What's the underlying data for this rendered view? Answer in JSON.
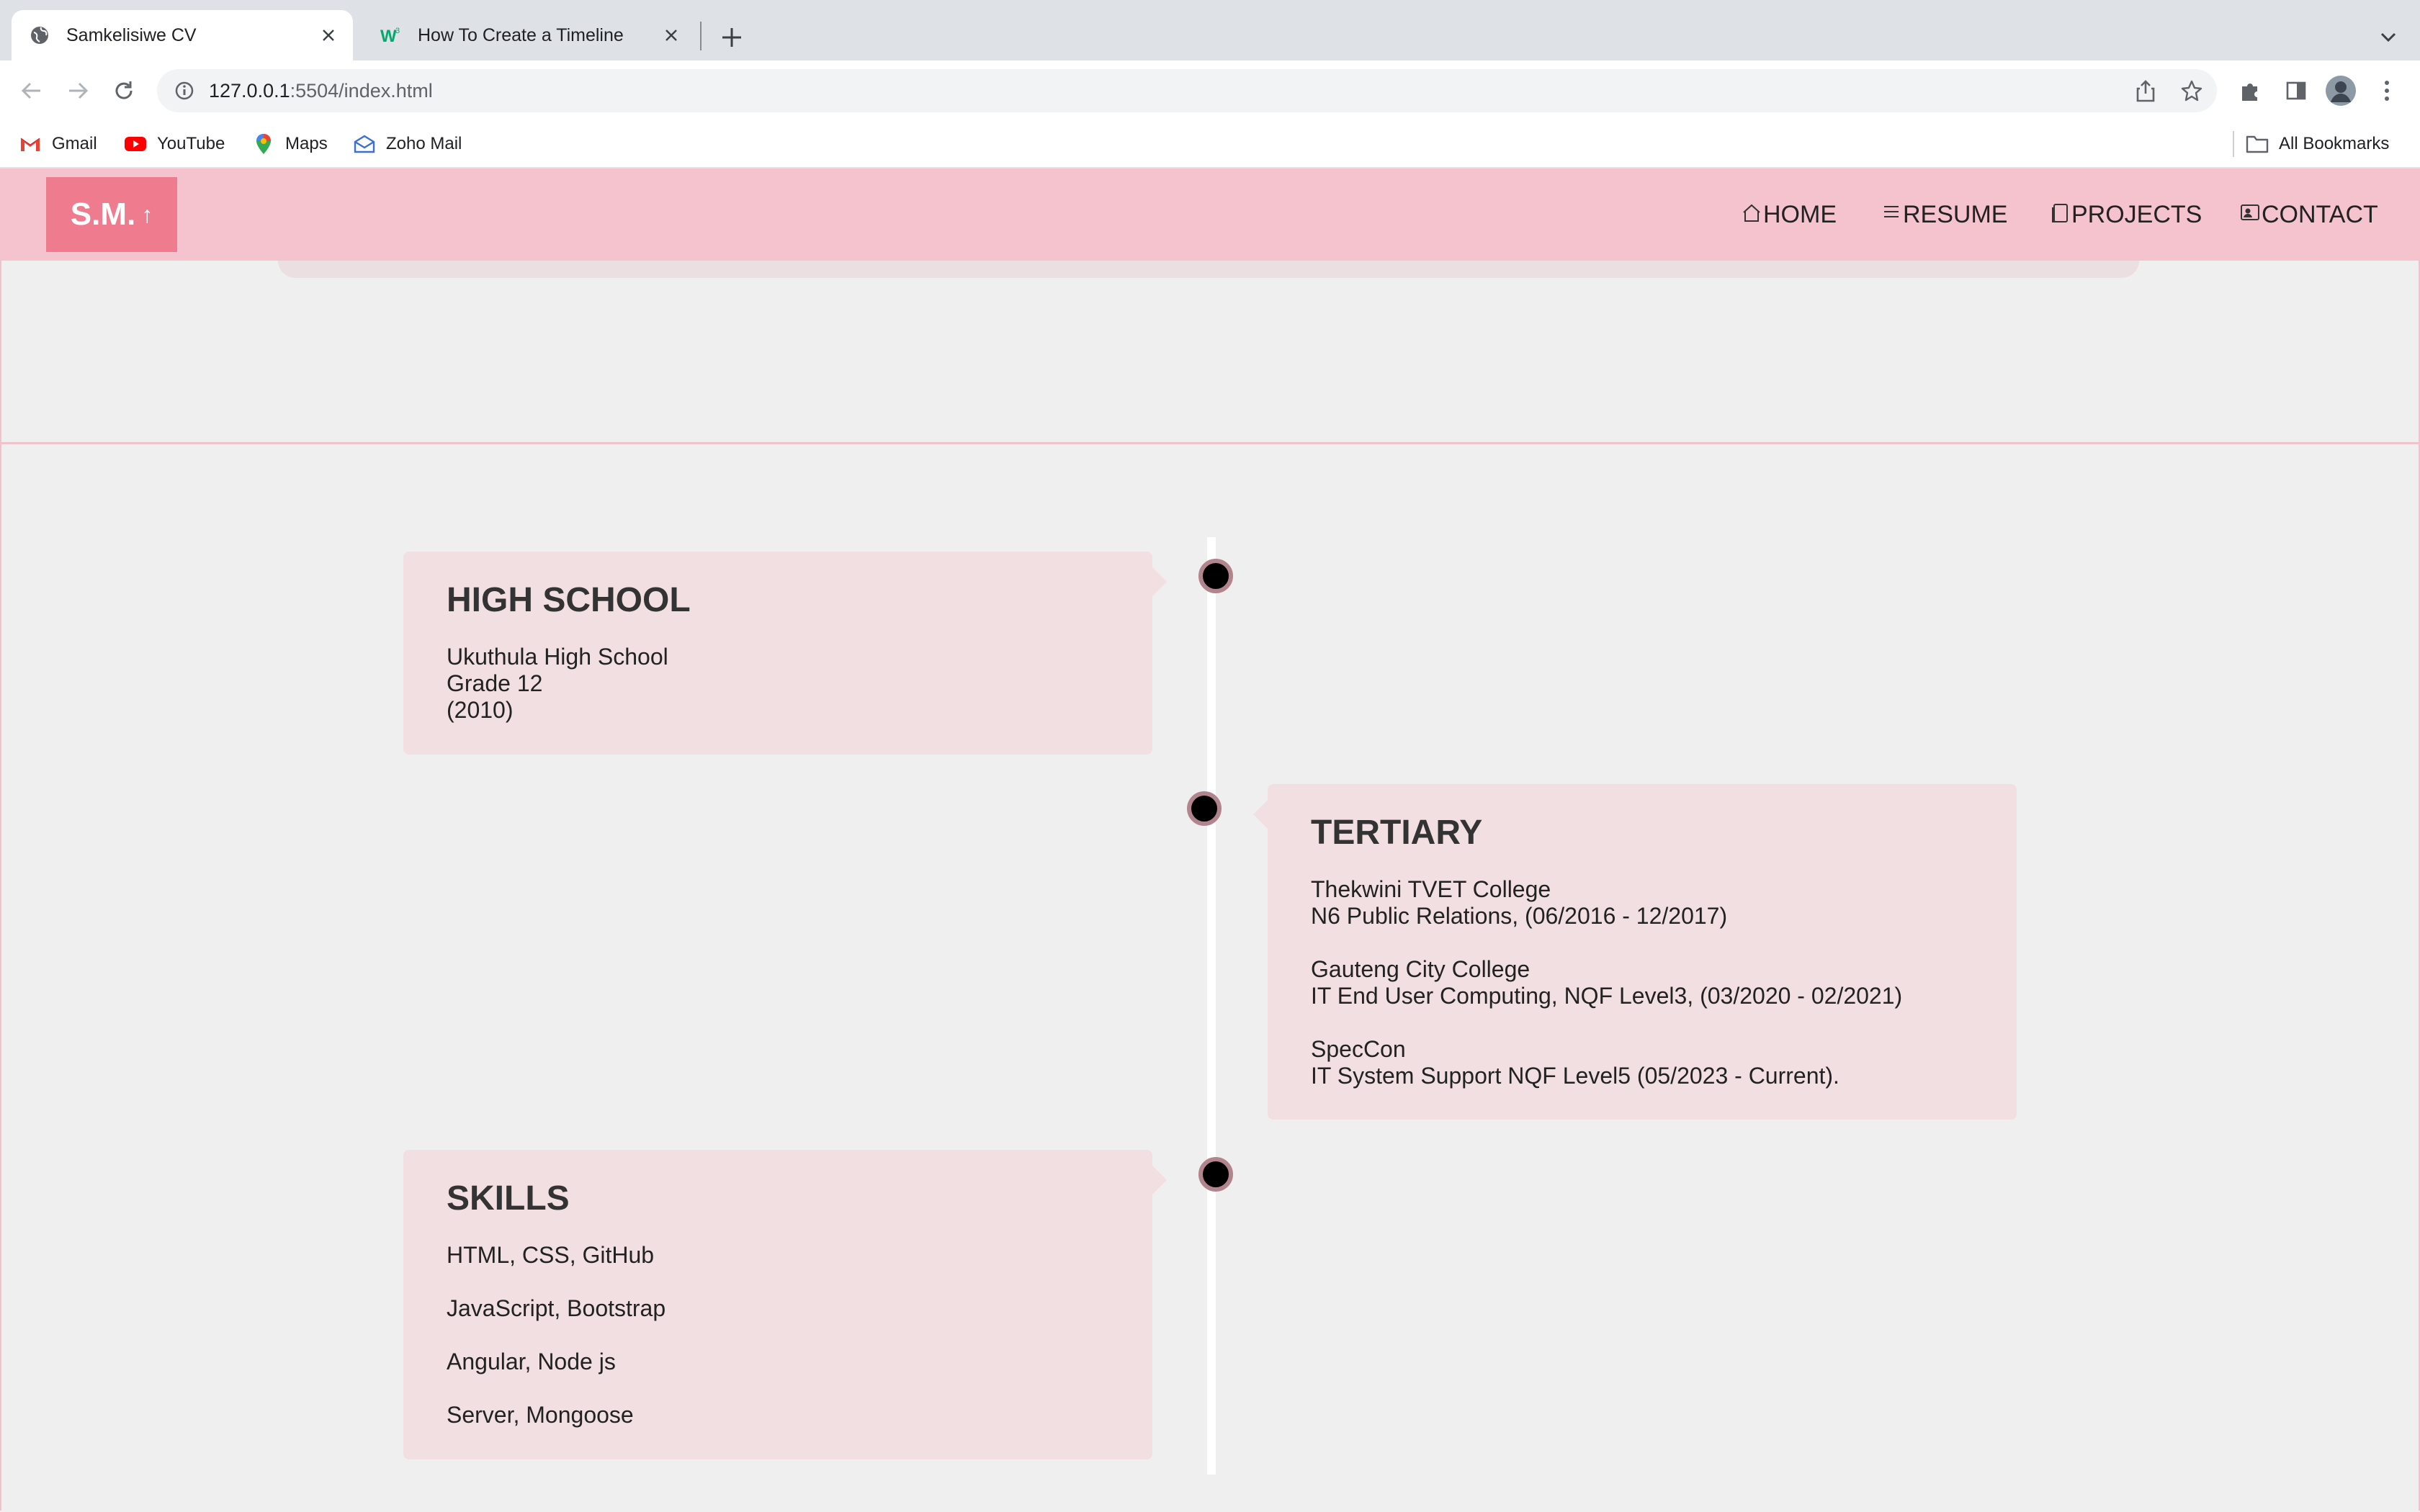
{
  "browser": {
    "tabs": [
      {
        "title": "Samkelisiwe CV",
        "icon": "globe-icon",
        "active": true
      },
      {
        "title": "How To Create a Timeline",
        "icon": "w3schools-icon",
        "active": false
      }
    ],
    "url_host": "127.0.0.1",
    "url_rest": ":5504/index.html",
    "bookmarks": [
      {
        "label": "Gmail",
        "icon": "gmail-icon"
      },
      {
        "label": "YouTube",
        "icon": "youtube-icon"
      },
      {
        "label": "Maps",
        "icon": "maps-icon"
      },
      {
        "label": "Zoho Mail",
        "icon": "zoho-mail-icon"
      }
    ],
    "all_bookmarks": "All Bookmarks"
  },
  "header": {
    "logo_text": "S.M.",
    "logo_arrow": "↑",
    "nav": [
      {
        "label": "HOME",
        "icon": "home-icon"
      },
      {
        "label": "RESUME",
        "icon": "menu-icon"
      },
      {
        "label": "PROJECTS",
        "icon": "document-icon"
      },
      {
        "label": "CONTACT",
        "icon": "contact-card-icon"
      }
    ]
  },
  "timeline": {
    "high_school": {
      "title": "HIGH SCHOOL",
      "lines": [
        "Ukuthula High School",
        "Grade 12",
        "(2010)"
      ]
    },
    "tertiary": {
      "title": "TERTIARY",
      "entries": [
        {
          "school": "Thekwini TVET College",
          "detail": "N6 Public Relations, (06/2016 - 12/2017)"
        },
        {
          "school": "Gauteng City College",
          "detail": "IT End User Computing, NQF Level3, (03/2020 - 02/2021)"
        },
        {
          "school": "SpecCon",
          "detail": "IT System Support NQF Level5 (05/2023 - Current)."
        }
      ]
    },
    "skills": {
      "title": "SKILLS",
      "items": [
        "HTML, CSS, GitHub",
        "JavaScript, Bootstrap",
        "Angular, Node js",
        "Server, Mongoose"
      ]
    }
  },
  "colors": {
    "header_bg": "#f5c3cd",
    "logo_bg": "#ef7c8e",
    "card_bg": "#f1dfe2",
    "page_bg": "#f0efef"
  }
}
